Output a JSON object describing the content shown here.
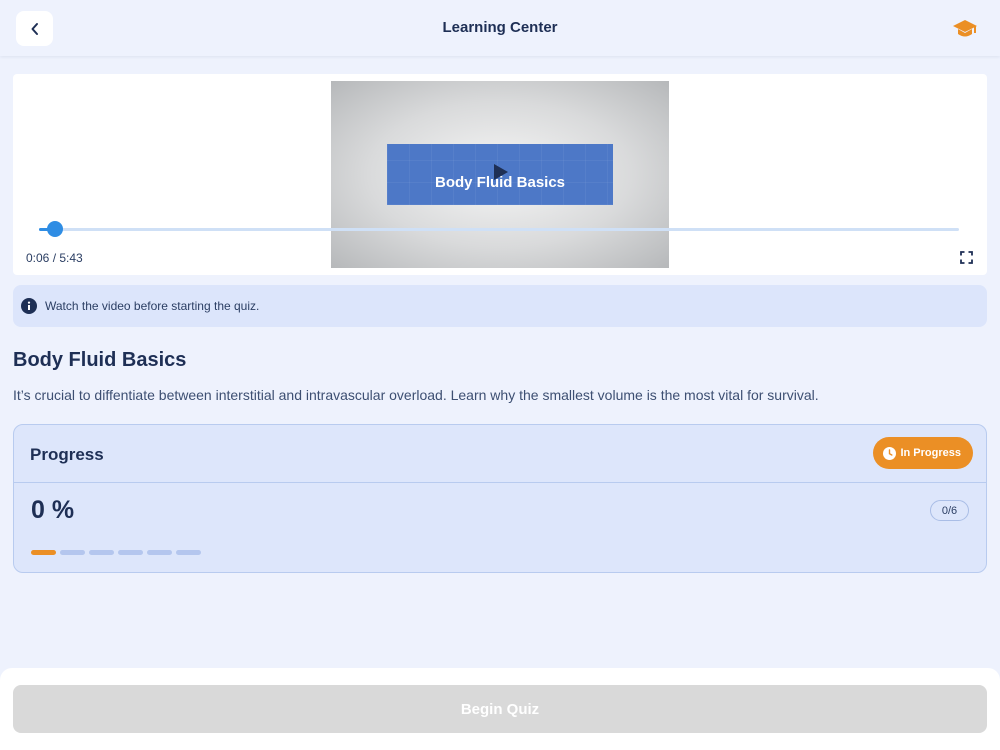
{
  "header": {
    "title": "Learning Center",
    "back_icon": "chevron-left-icon",
    "graduation_icon": "graduation-cap-icon",
    "accent_color": "#eb8f25"
  },
  "video": {
    "banner_title": "Body Fluid Basics",
    "current_time": "0:06",
    "duration": "5:43",
    "time_display": "0:06 / 5:43",
    "progress_fraction": 0.0175,
    "fullscreen_icon": "fullscreen-icon",
    "play_icon": "play-icon"
  },
  "notice": {
    "icon": "info-icon",
    "text": "Watch the video before starting the quiz."
  },
  "lesson": {
    "title": "Body Fluid Basics",
    "description": "It’s crucial to diffentiate between interstitial and intravascular overload. Learn why the smallest volume is the most vital for survival."
  },
  "progress": {
    "label": "Progress",
    "status": "In Progress",
    "status_icon": "clock-icon",
    "percent_text": "0 %",
    "count_text": "0/6",
    "completed": 0,
    "total": 6,
    "segments": [
      true,
      false,
      false,
      false,
      false,
      false
    ]
  },
  "footer": {
    "begin_quiz_label": "Begin Quiz",
    "begin_quiz_enabled": false
  }
}
